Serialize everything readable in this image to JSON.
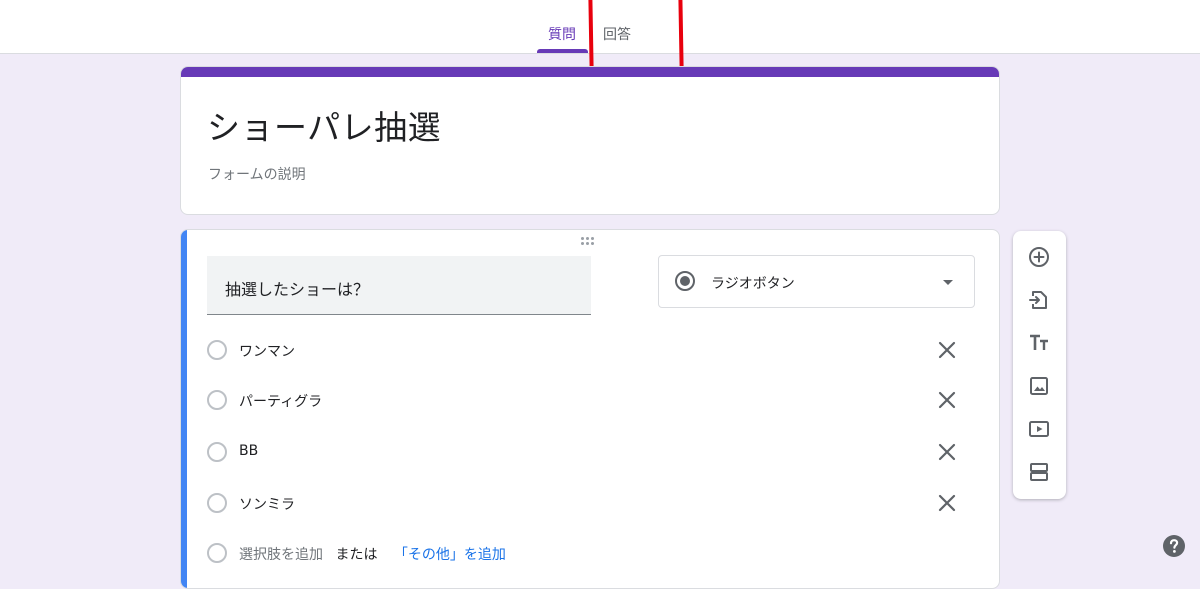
{
  "tabs": {
    "questions": "質問",
    "responses": "回答"
  },
  "form": {
    "title": "ショーパレ抽選",
    "description_placeholder": "フォームの説明"
  },
  "question": {
    "title": "抽選したショーは？",
    "type_label": "ラジオボタン",
    "options": [
      "ワンマン",
      "パーティグラ",
      "BB",
      "ソンミラ"
    ],
    "add_option": "選択肢を追加",
    "or": "または",
    "add_other": "「その他」を追加"
  },
  "toolbar": {
    "icons": [
      "add-question-icon",
      "import-questions-icon",
      "add-title-icon",
      "add-image-icon",
      "add-video-icon",
      "add-section-icon"
    ]
  },
  "colors": {
    "accent": "#673ab7",
    "active_question": "#4285f4",
    "background": "#f0ebf8",
    "annotation": "#e8000d"
  }
}
